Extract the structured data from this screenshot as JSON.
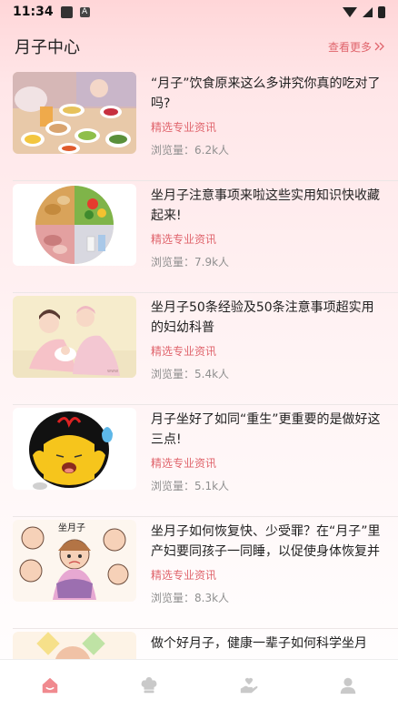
{
  "status": {
    "time": "11:34"
  },
  "header": {
    "title": "月子中心",
    "more_label": "查看更多"
  },
  "articles": [
    {
      "title": "“月子”饮食原来这么多讲究你真的吃对了吗?",
      "tag": "精选专业资讯",
      "views": "浏览量：6.2k人"
    },
    {
      "title": "坐月子注意事项来啦这些实用知识快收藏起来!",
      "tag": "精选专业资讯",
      "views": "浏览量：7.9k人"
    },
    {
      "title": "坐月子50条经验及50条注意事项超实用的妇幼科普",
      "tag": "精选专业资讯",
      "views": "浏览量：5.4k人"
    },
    {
      "title": "月子坐好了如同“重生”更重要的是做好这三点!",
      "tag": "精选专业资讯",
      "views": "浏览量：5.1k人"
    },
    {
      "title": "坐月子如何恢复快、少受罪？在“月子”里产妇要同孩子一同睡，以促使身体恢复并保...",
      "tag": "精选专业资讯",
      "views": "浏览量：8.3k人"
    },
    {
      "title": "做个好月子，健康一辈子如何科学坐月",
      "tag": "",
      "views": ""
    }
  ],
  "thumb_texts": {
    "article_5": "坐月子"
  },
  "colors": {
    "accent": "#e0656d",
    "tab_active": "#f08a8f",
    "tab_inactive": "#c9c9c9"
  },
  "tabs": [
    {
      "icon": "home-icon",
      "active": true
    },
    {
      "icon": "chef-hat-icon",
      "active": false
    },
    {
      "icon": "care-hand-icon",
      "active": false
    },
    {
      "icon": "user-icon",
      "active": false
    }
  ]
}
